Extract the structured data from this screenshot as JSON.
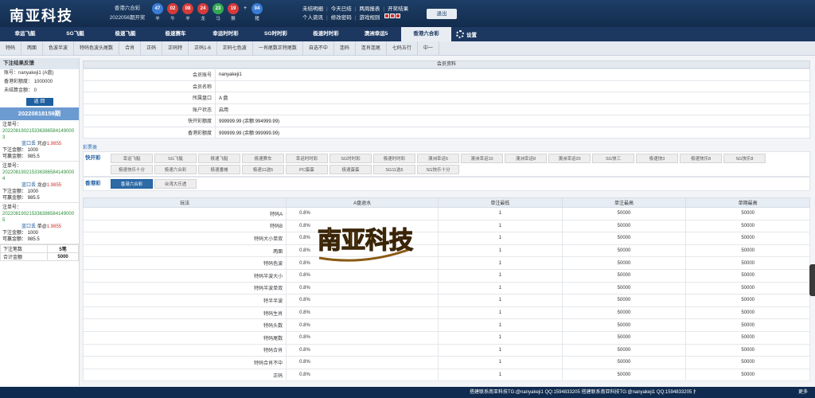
{
  "header": {
    "logo": "南亚科技",
    "lottery_name": "香港六合彩",
    "lottery_period": "2022056期开奖",
    "balls": [
      {
        "num": "47",
        "label": "羊",
        "color": "#3a7bd5"
      },
      {
        "num": "02",
        "label": "牛",
        "color": "#d63a3a"
      },
      {
        "num": "08",
        "label": "羊",
        "color": "#d63a3a"
      },
      {
        "num": "24",
        "label": "龙",
        "color": "#d63a3a"
      },
      {
        "num": "23",
        "label": "马",
        "color": "#34a853"
      },
      {
        "num": "19",
        "label": "猴",
        "color": "#d63a3a"
      },
      {
        "num": "04",
        "label": "猪",
        "color": "#3a7bd5"
      }
    ],
    "plus": "+",
    "links_row1": [
      "未结明细",
      "今天已结",
      "两周报表",
      "开奖结果"
    ],
    "links_row2": [
      "个人资讯",
      "修改密码",
      "游戏规则"
    ],
    "logout": "退出"
  },
  "nav": {
    "items": [
      "幸运飞艇",
      "SG飞艇",
      "极速飞艇",
      "极速赛车",
      "幸运时时彩",
      "SG时时彩",
      "极速时时彩",
      "澳洲幸运5",
      "香港六合彩"
    ],
    "active_index": 8,
    "settings": "设置"
  },
  "subnav": [
    "特码",
    "两面",
    "色波半波",
    "特码色波头尾数",
    "合肖",
    "正码",
    "正码特",
    "正码1-6",
    "正码七色波",
    "一肖尾数正特尾数",
    "自选不中",
    "连码",
    "连肖连尾",
    "七码五行",
    "中一"
  ],
  "sidebar": {
    "title": "下注结果反馈",
    "account_line": "账号：nanyakeji1 (A盘)",
    "credit_line": "香港彩额度：    1000000",
    "unsettled_line": "未结算金额：    0",
    "back": "返 回",
    "period": "20220818159期",
    "orders": [
      {
        "label": "注单号：",
        "number": "2022081902153363865841490003",
        "pick": "蓝口丢",
        "pick_target": "兄@",
        "odds": "1.9855",
        "bet_line": "下注金额：  1000",
        "win_line": "可赢金额：  985.5"
      },
      {
        "label": "注单号：",
        "number": "2022081902153363865841490004",
        "pick": "蓝口丢",
        "pick_target": "龙@",
        "odds": "1.9855",
        "bet_line": "下注金额：  1000",
        "win_line": "可赢金额：  985.5"
      },
      {
        "label": "注单号：",
        "number": "2022081902153363865841490005",
        "pick": "蓝口丢",
        "pick_target": "单@",
        "odds": "1.9855",
        "bet_line": "下注金额：  1000",
        "win_line": "可赢金额：  985.5"
      }
    ],
    "summary": [
      {
        "k": "下注笔数",
        "v": "5笔"
      },
      {
        "k": "合计金额",
        "v": "5000"
      }
    ]
  },
  "member": {
    "title": "会员资料",
    "rows": [
      {
        "k": "会员账号",
        "v": "nanyakeji1"
      },
      {
        "k": "会员名称",
        "v": ""
      },
      {
        "k": "所属盘口",
        "v": "A 盘"
      },
      {
        "k": "账户状态",
        "v": "启用"
      },
      {
        "k": "快开彩额度",
        "v": "999999.99 (余额:994999.99)"
      },
      {
        "k": "香港彩额度",
        "v": "999999.99 (余额:999999.99)"
      }
    ]
  },
  "rebate": {
    "title": "彩票类",
    "groups": [
      {
        "name": "快开彩",
        "items": [
          "幸运飞艇",
          "SG飞艇",
          "极速飞艇",
          "极速赛车",
          "幸运时时彩",
          "SG时时彩",
          "极速时时彩",
          "澳洲幸运5",
          "澳洲幸运10",
          "澳洲幸运8",
          "澳洲幸运20",
          "SG快三",
          "极速快3",
          "极速快乐8",
          "SG快乐8",
          "极速快乐十分",
          "极速六合彩",
          "极速番摊",
          "极速11选5",
          "PC蛋蛋",
          "极速蛋蛋",
          "SG11选5",
          "SG快乐十分"
        ],
        "active": -1
      },
      {
        "name": "香港彩",
        "items": [
          "香港六合彩",
          "台湾大乐透"
        ],
        "active": 0
      }
    ]
  },
  "bet_table": {
    "headers": [
      "玩法",
      "A盘退水",
      "单注最低",
      "单注最高",
      "单期最高"
    ],
    "rows": [
      [
        "特码A",
        "0.8%",
        "1",
        "50000",
        "50000"
      ],
      [
        "特码B",
        "0.8%",
        "1",
        "50000",
        "50000"
      ],
      [
        "特码大小单双",
        "0.8%",
        "1",
        "50000",
        "50000"
      ],
      [
        "两面",
        "0.8%",
        "1",
        "50000",
        "50000"
      ],
      [
        "特码色波",
        "0.8%",
        "1",
        "50000",
        "50000"
      ],
      [
        "特码半波大小",
        "0.8%",
        "1",
        "50000",
        "50000"
      ],
      [
        "特码半波单双",
        "0.8%",
        "1",
        "50000",
        "50000"
      ],
      [
        "特半半波",
        "0.8%",
        "1",
        "50000",
        "50000"
      ],
      [
        "特码生肖",
        "0.8%",
        "1",
        "50000",
        "50000"
      ],
      [
        "特码头数",
        "0.8%",
        "1",
        "50000",
        "50000"
      ],
      [
        "特码尾数",
        "0.8%",
        "1",
        "50000",
        "50000"
      ],
      [
        "特码合肖",
        "0.8%",
        "1",
        "50000",
        "50000"
      ],
      [
        "特码合肖不中",
        "0.8%",
        "1",
        "50000",
        "50000"
      ],
      [
        "正码",
        "0.8%",
        "1",
        "50000",
        "50000"
      ]
    ]
  },
  "watermark": "南亚科技",
  "footer": {
    "contact": "搭建联系南亚科技TG:@nanyakeji1 QQ:1594833205 搭建联系南亚科技TG:@nanyakeji1 QQ:1594833205 扌",
    "more": "更多"
  }
}
